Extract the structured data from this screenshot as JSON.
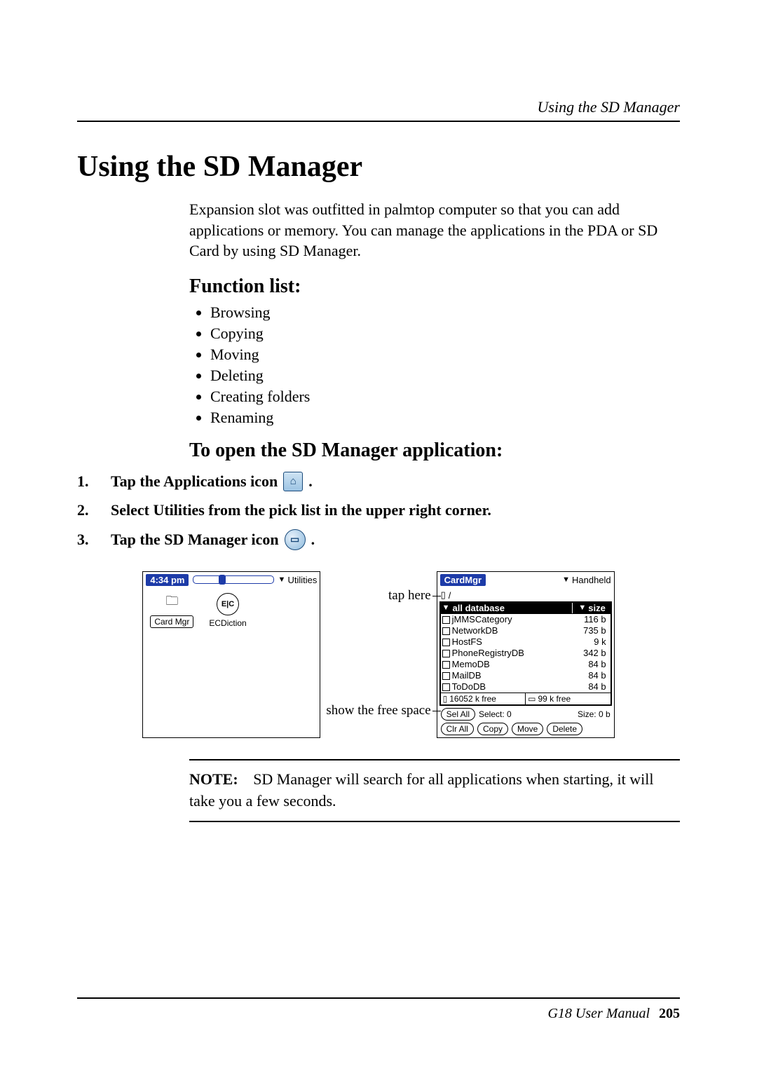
{
  "running_head": "Using the SD Manager",
  "title": "Using the SD Manager",
  "intro": "Expansion slot was outfitted in palmtop computer so that you can add applications or memory. You can manage the applications in the PDA or SD Card by using SD Manager.",
  "function_list_heading": "Function list:",
  "functions": [
    "Browsing",
    "Copying",
    "Moving",
    "Deleting",
    "Creating folders",
    "Renaming"
  ],
  "open_heading": "To open the SD Manager application:",
  "steps": {
    "s1_pre": "Tap the Applications icon ",
    "s1_post": " .",
    "s2": "Select Utilities from the pick list in the upper right corner.",
    "s3_pre": "Tap the SD Manager icon ",
    "s3_post": "  ."
  },
  "annotations": {
    "tap_here": "tap here",
    "show_free": "show the free space"
  },
  "launcher": {
    "time": "4:34 pm",
    "category": "Utilities",
    "apps": [
      {
        "label": "Card Mgr",
        "glyph": "▭"
      },
      {
        "label": "ECDiction",
        "glyph": "E|C"
      }
    ]
  },
  "cardmgr": {
    "title": "CardMgr",
    "location_drop": "Handheld",
    "col_db": "all database",
    "col_size": "size",
    "rows": [
      {
        "name": "jMMSCategory",
        "size": "116 b"
      },
      {
        "name": "NetworkDB",
        "size": "735 b"
      },
      {
        "name": "HostFS",
        "size": "9 k"
      },
      {
        "name": "PhoneRegistryDB",
        "size": "342 b"
      },
      {
        "name": "MemoDB",
        "size": "84 b"
      },
      {
        "name": "MailDB",
        "size": "84 b"
      },
      {
        "name": "ToDoDB",
        "size": "84 b"
      }
    ],
    "free_left": "16052 k free",
    "free_right": "99 k free",
    "sel_btn": "Sel All",
    "select_label": "Select: 0",
    "size_label": "Size: 0 b",
    "buttons": [
      "Clr All",
      "Copy",
      "Move",
      "Delete"
    ]
  },
  "note": {
    "label": "NOTE:",
    "text": "SD Manager will search for all applications when starting, it will take you a few seconds."
  },
  "footer": {
    "manual": "G18 User Manual",
    "page": "205"
  }
}
